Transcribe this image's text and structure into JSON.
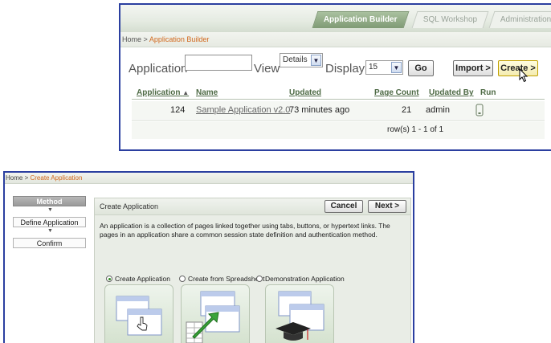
{
  "builder": {
    "tabs": [
      {
        "label": "Application Builder",
        "active": true
      },
      {
        "label": "SQL Workshop",
        "active": false
      },
      {
        "label": "Administration",
        "active": false
      }
    ],
    "breadcrumb": {
      "home": "Home",
      "sep": ">",
      "current": "Application Builder"
    },
    "search": {
      "application_label": "Application",
      "application_value": "",
      "view_label": "View",
      "view_value": "Details",
      "display_label": "Display",
      "display_value": "15",
      "go_button": "Go",
      "import_button": "Import >",
      "create_button": "Create >"
    },
    "table": {
      "headers": [
        "Application",
        "Name",
        "Updated",
        "Page Count",
        "Updated By",
        "Run"
      ],
      "sort_indicator": "▲",
      "rows": [
        {
          "application": "124",
          "name": "Sample Application v2.0",
          "updated": "73 minutes ago",
          "page_count": "21",
          "updated_by": "admin"
        }
      ],
      "pagination": "row(s) 1 - 1 of 1"
    }
  },
  "create": {
    "breadcrumb": {
      "home": "Home",
      "sep": ">",
      "current": "Create Application"
    },
    "steps": [
      {
        "label": "Method",
        "active": true
      },
      {
        "label": "Define Application",
        "active": false
      },
      {
        "label": "Confirm",
        "active": false
      }
    ],
    "region_title": "Create Application",
    "cancel_button": "Cancel",
    "next_button": "Next >",
    "description": "An application is a collection of pages linked together using tabs, buttons, or hypertext links. The pages in an application share a common session state definition and authentication method.",
    "options": [
      {
        "label": "Create Application",
        "selected": true,
        "icon": "create-application-icon"
      },
      {
        "label": "Create from Spreadsheet",
        "selected": false,
        "icon": "spreadsheet-import-icon"
      },
      {
        "label": "Demonstration Application",
        "selected": false,
        "icon": "demonstration-application-icon"
      }
    ]
  },
  "colors": {
    "frame": "#2b3fa0",
    "breadcrumb_current": "#d2691e",
    "header_link": "#4e6a45",
    "active_tab": "#8fab84"
  }
}
